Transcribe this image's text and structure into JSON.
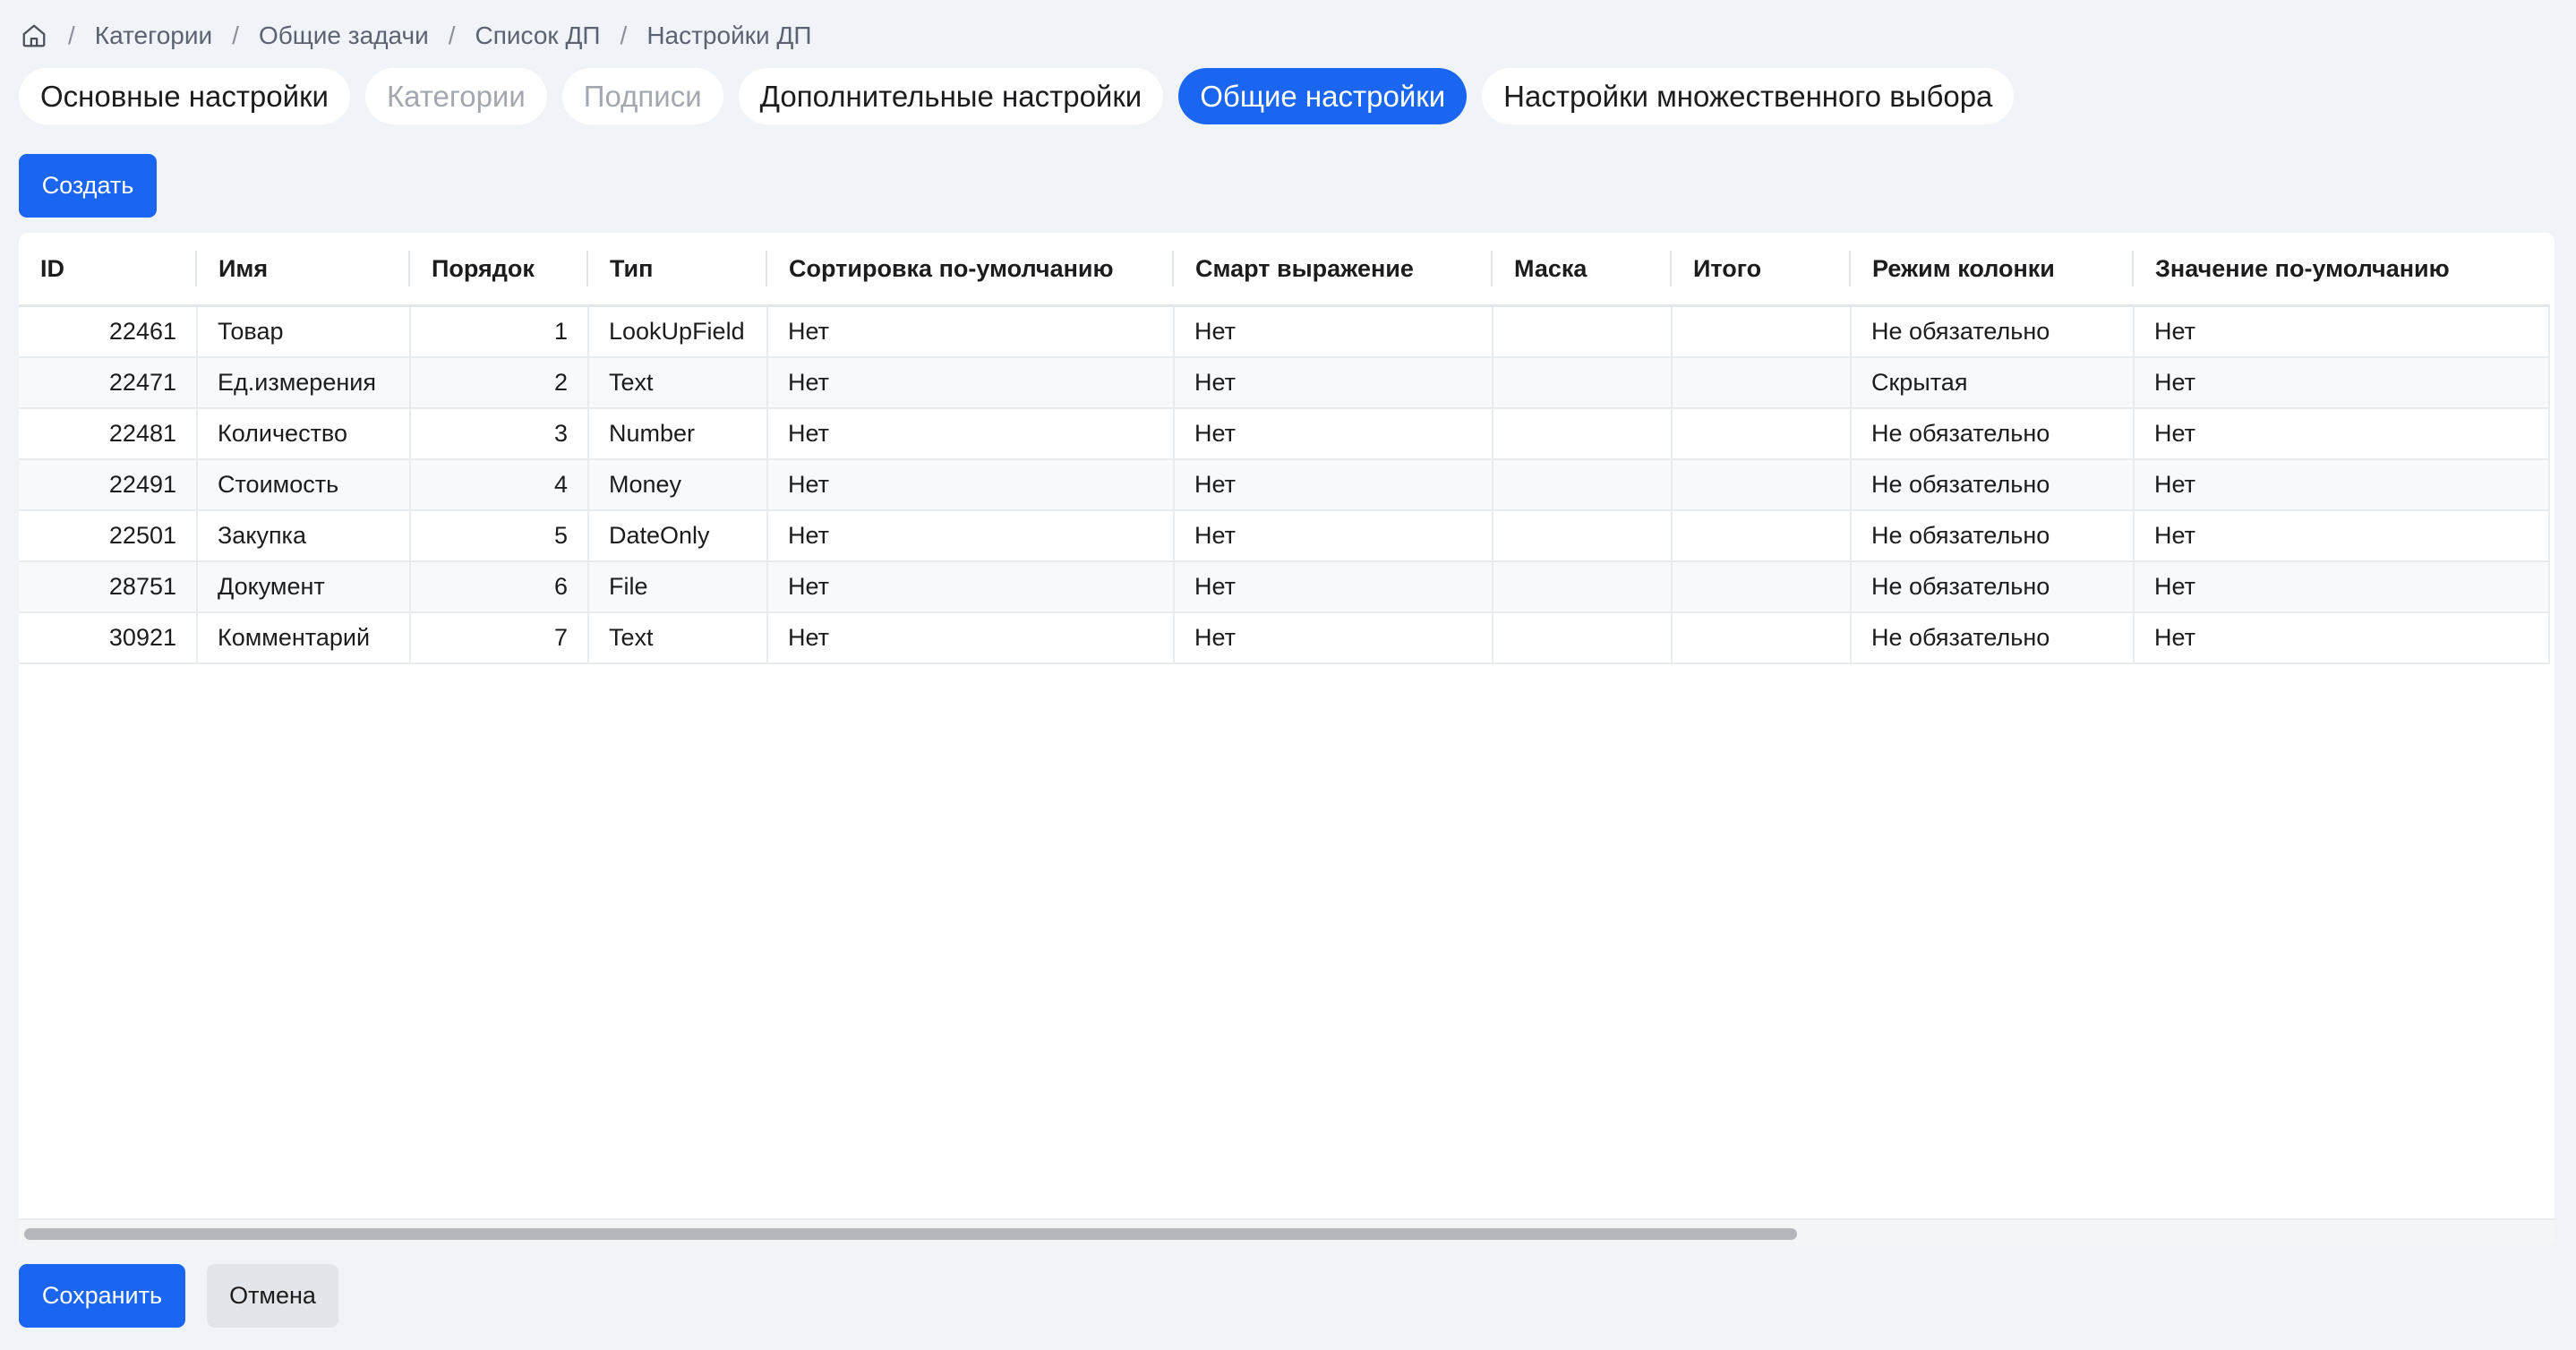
{
  "breadcrumb": {
    "items": [
      "Категории",
      "Общие задачи",
      "Список ДП",
      "Настройки ДП"
    ]
  },
  "tabs": [
    {
      "label": "Основные настройки",
      "state": "normal"
    },
    {
      "label": "Категории",
      "state": "disabled"
    },
    {
      "label": "Подписи",
      "state": "disabled"
    },
    {
      "label": "Дополнительные настройки",
      "state": "normal"
    },
    {
      "label": "Общие настройки",
      "state": "active"
    },
    {
      "label": "Настройки множественного выбора",
      "state": "normal"
    }
  ],
  "toolbar": {
    "create_label": "Создать"
  },
  "table": {
    "columns": [
      "ID",
      "Имя",
      "Порядок",
      "Тип",
      "Сортировка по-умолчанию",
      "Смарт выражение",
      "Маска",
      "Итого",
      "Режим колонки",
      "Значение по-умолчанию"
    ],
    "rows": [
      [
        "22461",
        "Товар",
        "1",
        "LookUpField",
        "Нет",
        "Нет",
        "",
        "",
        "Не обязательно",
        "Нет"
      ],
      [
        "22471",
        "Ед.измерения",
        "2",
        "Text",
        "Нет",
        "Нет",
        "",
        "",
        "Скрытая",
        "Нет"
      ],
      [
        "22481",
        "Количество",
        "3",
        "Number",
        "Нет",
        "Нет",
        "",
        "",
        "Не обязательно",
        "Нет"
      ],
      [
        "22491",
        "Стоимость",
        "4",
        "Money",
        "Нет",
        "Нет",
        "",
        "",
        "Не обязательно",
        "Нет"
      ],
      [
        "22501",
        "Закупка",
        "5",
        "DateOnly",
        "Нет",
        "Нет",
        "",
        "",
        "Не обязательно",
        "Нет"
      ],
      [
        "28751",
        "Документ",
        "6",
        "File",
        "Нет",
        "Нет",
        "",
        "",
        "Не обязательно",
        "Нет"
      ],
      [
        "30921",
        "Комментарий",
        "7",
        "Text",
        "Нет",
        "Нет",
        "",
        "",
        "Не обязательно",
        "Нет"
      ]
    ]
  },
  "footer": {
    "save_label": "Сохранить",
    "cancel_label": "Отмена"
  },
  "colors": {
    "accent": "#1a66f0",
    "background": "#f0f3f7",
    "disabled_text": "#a3a8b0"
  }
}
